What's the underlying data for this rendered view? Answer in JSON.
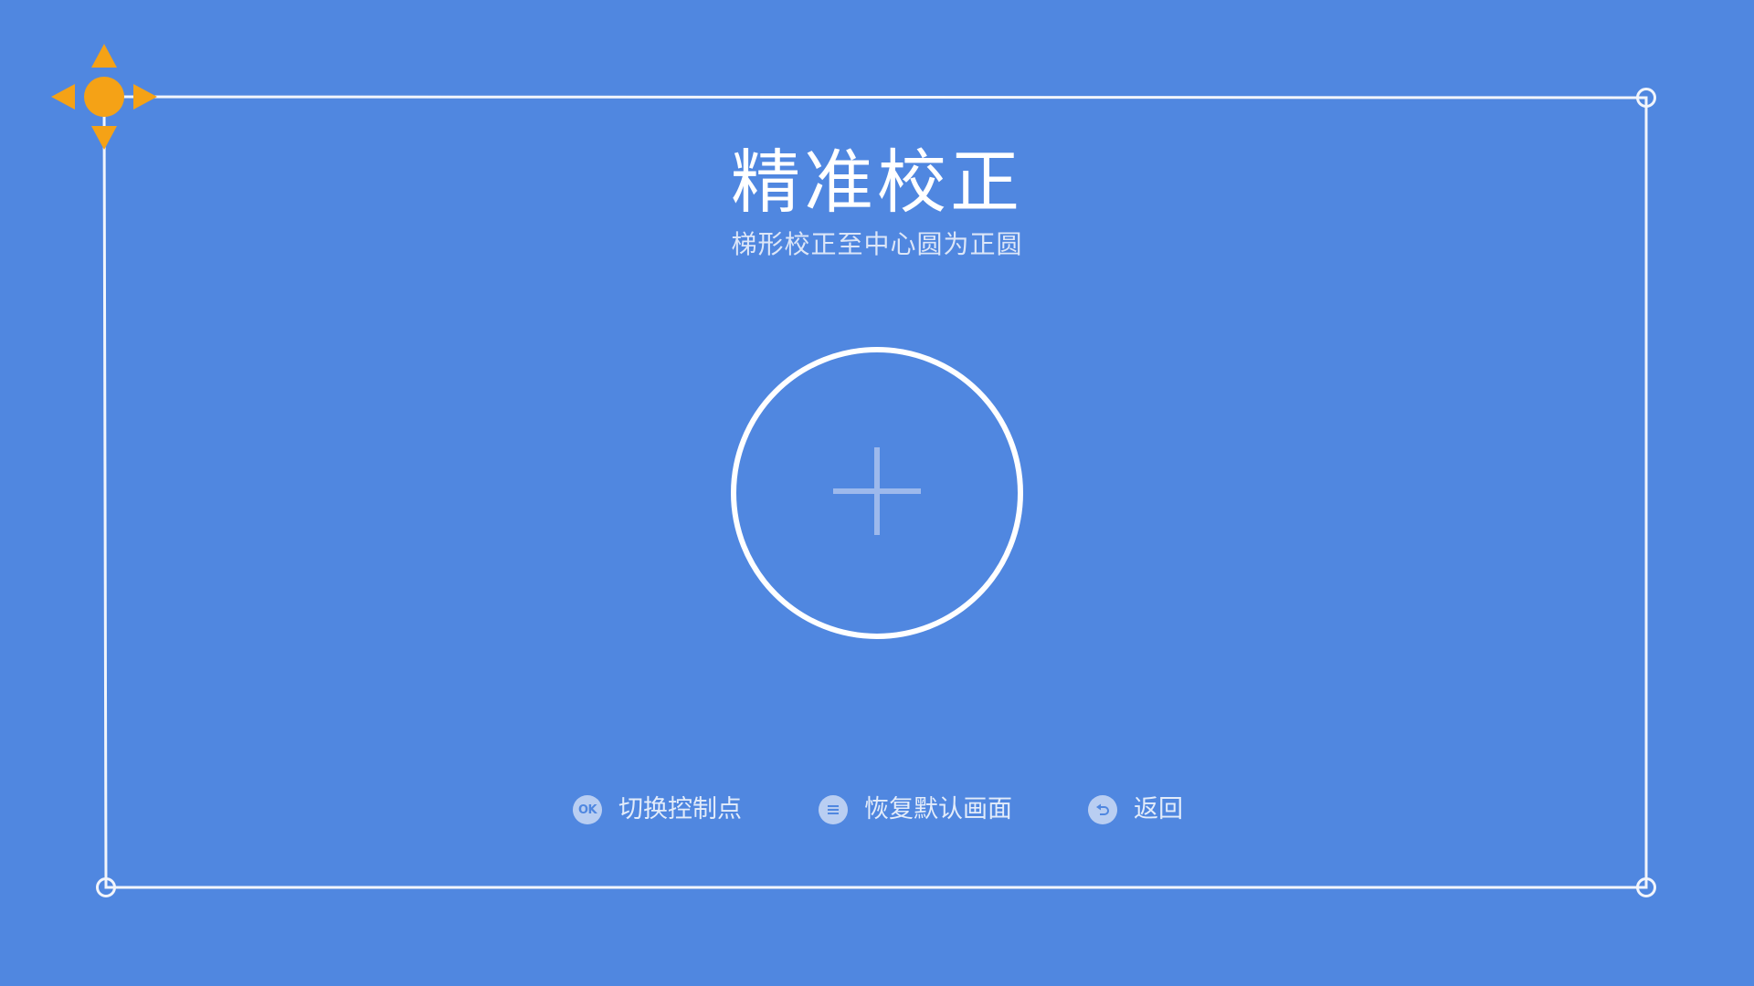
{
  "screen": {
    "background_color": "#5087E0",
    "frame_color": "#F2F5FB",
    "active_handle_color": "#F5A216"
  },
  "header": {
    "title": "精准校正",
    "subtitle": "梯形校正至中心圆为正圆"
  },
  "hints": [
    {
      "icon": "ok-button-icon",
      "icon_text": "OK",
      "label": "切换控制点"
    },
    {
      "icon": "menu-button-icon",
      "label": "恢复默认画面"
    },
    {
      "icon": "back-button-icon",
      "label": "返回"
    }
  ]
}
